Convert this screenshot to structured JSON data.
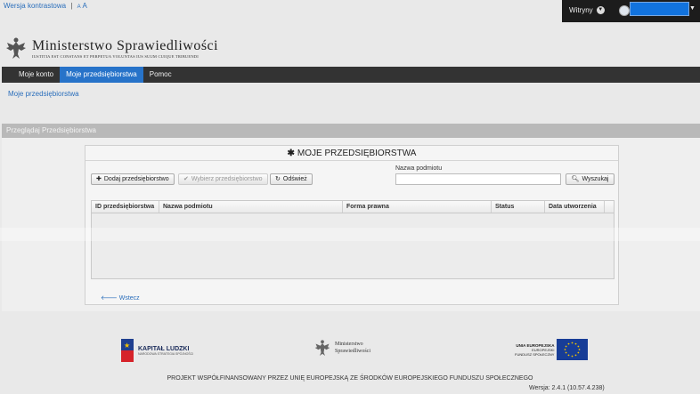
{
  "accessibility": {
    "contrast_link": "Wersja kontrastowa",
    "separator": "|",
    "font_small": "A",
    "font_large": "A"
  },
  "topbar": {
    "sites_label": "Witryny",
    "sites_caret_icon": "caret-down-icon",
    "user_caret_icon": "caret-down-icon"
  },
  "logo": {
    "title": "Ministerstwo Sprawiedliwości",
    "motto": "IUSTITIA EST CONSTANS ET PERPETUA VOLUNTAS IUS SUUM CUIQUE TRIBUENDI"
  },
  "nav": {
    "items": [
      {
        "label": "Moje konto",
        "active": false
      },
      {
        "label": "Moje przedsiębiorstwa",
        "active": true
      },
      {
        "label": "Pomoc",
        "active": false
      }
    ]
  },
  "breadcrumb": "Moje przedsiębiorstwa",
  "panel": {
    "header": "Przeglądaj Przedsiębiorstwa",
    "title": "MOJE PRZEDSIĘBIORSTWA",
    "title_icon": "asterisk-icon",
    "buttons": {
      "add": "Dodaj przedsiębiorstwo",
      "select": "Wybierz przedsiębiorstwo",
      "refresh": "Odśwież",
      "search": "Wyszukaj"
    },
    "search": {
      "label": "Nazwa podmiotu",
      "value": ""
    },
    "table": {
      "columns": [
        "ID przedsiębiorstwa",
        "Nazwa podmiotu",
        "Forma prawna",
        "Status",
        "Data utworzenia"
      ],
      "rows": []
    },
    "back_link": "Wstecz"
  },
  "footer": {
    "kl_title": "KAPITAŁ LUDZKI",
    "kl_sub": "NARODOWA STRATEGIA SPÓJNOŚCI",
    "ms_line1": "Ministerstwo",
    "ms_line2": "Sprawiedliwości",
    "eu_line1": "UNIA EUROPEJSKA",
    "eu_line2": "EUROPEJSKI",
    "eu_line3": "FUNDUSZ SPOŁECZNY",
    "project": "PROJEKT WSPÓŁFINANSOWANY PRZEZ UNIĘ EUROPEJSKĄ ZE ŚRODKÓW EUROPEJSKIEGO FUNDUSZU SPOŁECZNEGO",
    "version": "Wersja: 2.4.1 (10.57.4.238)"
  },
  "colors": {
    "accent": "#2773c9",
    "nav_bg": "#333333",
    "link": "#2a6ebb"
  }
}
